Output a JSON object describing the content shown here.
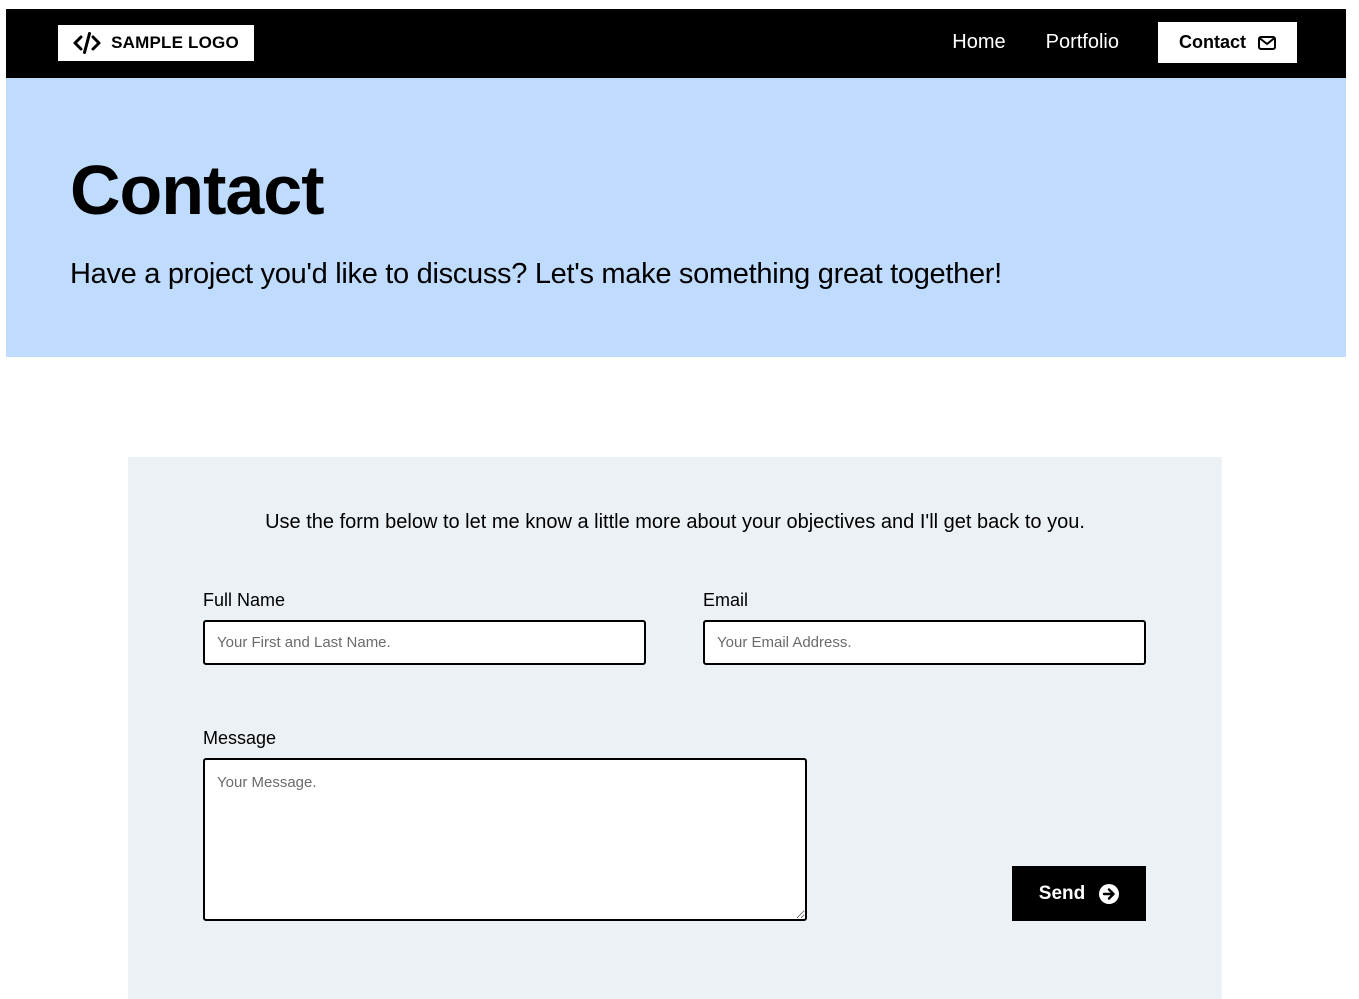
{
  "header": {
    "logo_text": "SAMPLE LOGO",
    "logo_icon": "code-icon",
    "nav": {
      "home_label": "Home",
      "portfolio_label": "Portfolio",
      "contact_label": "Contact",
      "contact_icon": "envelope-icon"
    }
  },
  "hero": {
    "title": "Contact",
    "subtitle": "Have a project you'd like to discuss? Let's make something great together!"
  },
  "form": {
    "intro": "Use the form below to let me know a little more about your objectives and I'll get back to you.",
    "full_name": {
      "label": "Full Name",
      "placeholder": "Your First and Last Name."
    },
    "email": {
      "label": "Email",
      "placeholder": "Your Email Address."
    },
    "message": {
      "label": "Message",
      "placeholder": "Your Message."
    },
    "send_label": "Send",
    "send_icon": "arrow-circle-right-icon"
  },
  "colors": {
    "header_bg": "#000000",
    "hero_bg": "#bfdbfe",
    "card_bg": "#ecf1f5"
  }
}
